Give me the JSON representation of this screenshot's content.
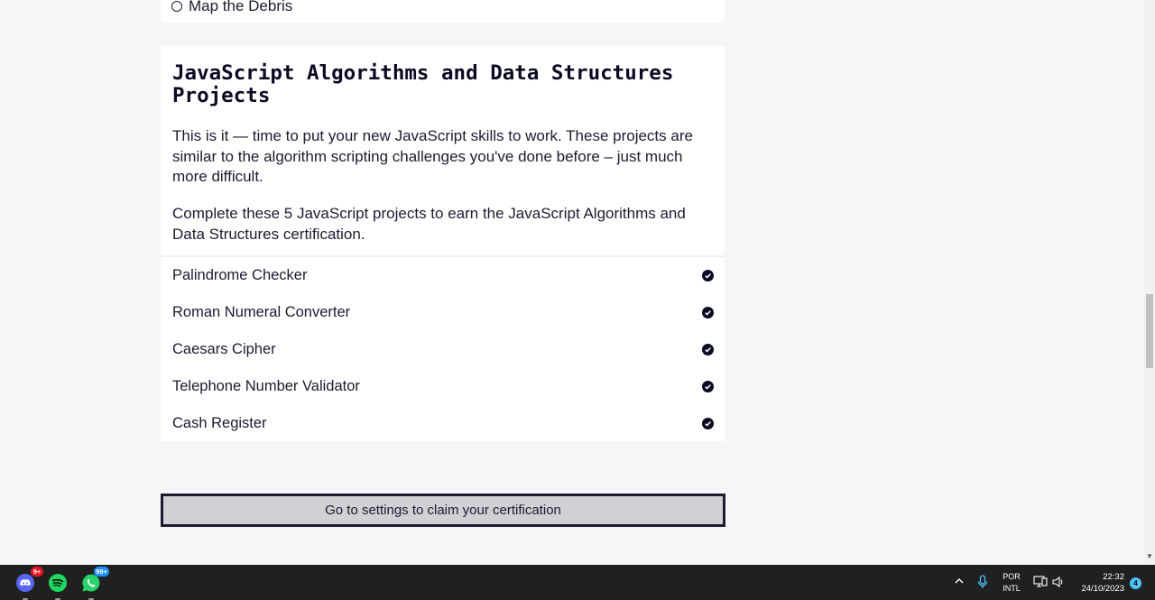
{
  "previous_block": {
    "last_item_label": "Map the Debris"
  },
  "block": {
    "title": "JavaScript Algorithms and Data Structures Projects",
    "intro": "This is it — time to put your new JavaScript skills to work. These projects are similar to the algorithm scripting challenges you've done before – just much more difficult.",
    "summary": "Complete these 5 JavaScript projects to earn the JavaScript Algorithms and Data Structures certification.",
    "challenges": [
      {
        "label": "Palindrome Checker",
        "completed": true
      },
      {
        "label": "Roman Numeral Converter",
        "completed": true
      },
      {
        "label": "Caesars Cipher",
        "completed": true
      },
      {
        "label": "Telephone Number Validator",
        "completed": true
      },
      {
        "label": "Cash Register",
        "completed": true
      }
    ]
  },
  "claim_button": {
    "label": "Go to settings to claim your certification"
  },
  "taskbar": {
    "apps": [
      {
        "name": "discord",
        "badge": "9+",
        "badge_color": "#e81123"
      },
      {
        "name": "spotify",
        "badge": ""
      },
      {
        "name": "whatsapp",
        "badge": "99+",
        "badge_color": "#1e90ff"
      }
    ],
    "language_line1": "POR",
    "language_line2": "INTL",
    "time": "22:32",
    "date": "24/10/2023",
    "notification_count": "4"
  },
  "colors": {
    "page_bg": "#f5f6f7",
    "text": "#1b1b32",
    "button_bg": "#d0d0d5",
    "taskbar_bg": "#202020"
  }
}
